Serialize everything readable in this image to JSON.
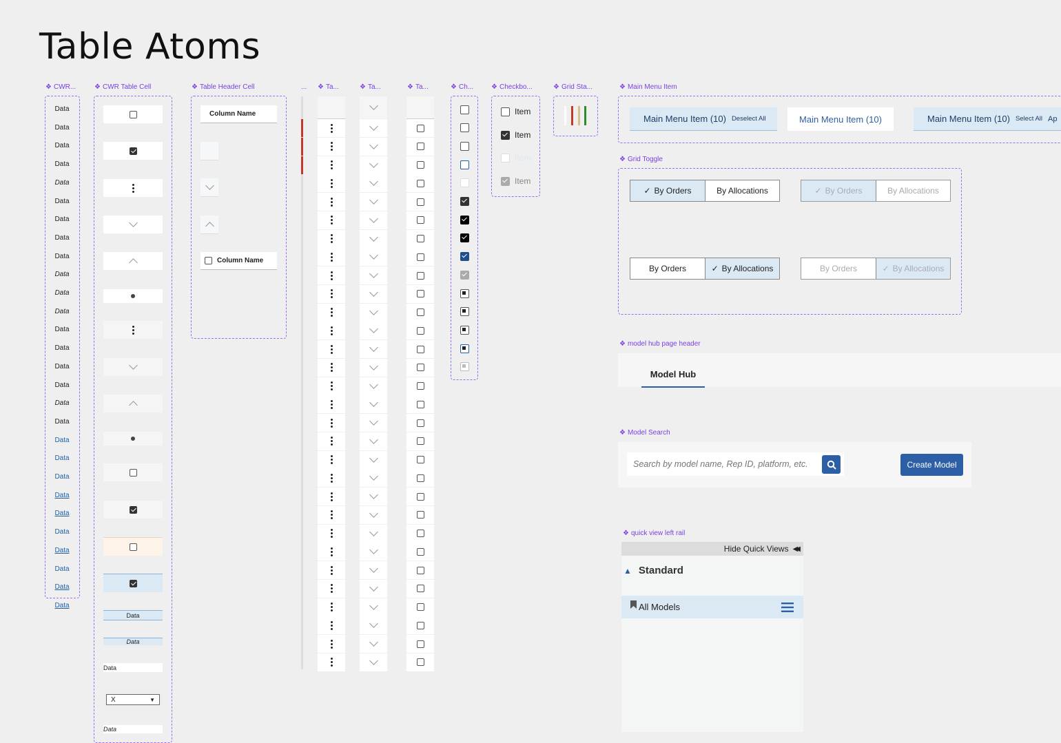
{
  "page": {
    "title": "Table Atoms"
  },
  "labels": {
    "cwr_col": "CWR...",
    "cwr_table_cell": "CWR Table Cell",
    "table_header_cell": "Table Header Cell",
    "dots": "...",
    "ta1": "Ta...",
    "ta2": "Ta...",
    "ta3": "Ta...",
    "ch": "Ch...",
    "checkbox": "Checkbo...",
    "grid_sta": "Grid Sta...",
    "main_menu_item": "Main Menu Item",
    "grid_toggle": "Grid Toggle",
    "model_hub_page_header": "model hub page header",
    "model_search": "Model Search",
    "quick_view_left_rail": "quick view left rail"
  },
  "cwr_data": [
    "Data",
    "Data",
    "Data",
    "Data",
    "Data",
    "Data",
    "Data",
    "Data",
    "Data",
    "Data",
    "Data",
    "Data",
    "Data",
    "Data",
    "Data",
    "Data",
    "Data",
    "Data",
    "Data",
    "Data",
    "Data",
    "Data",
    "Data",
    "Data",
    "Data",
    "Data",
    "Data",
    "Data"
  ],
  "cwr_table_cell": {
    "data1": "Data",
    "data2": "Data",
    "data3": "Data",
    "select_value": "X",
    "data4": "Data"
  },
  "header_cell": {
    "column_name": "Column Name",
    "column_name_cb": "Column Name"
  },
  "checkbox_group": {
    "items": [
      "Item",
      "Item",
      "Item",
      "Item"
    ]
  },
  "main_menu": {
    "item1": "Main Menu Item (10)",
    "item1_action": "Deselect All",
    "item2": "Main Menu Item (10)",
    "item3": "Main Menu Item (10)",
    "item3_action": "Select All",
    "item3_more": "Ap"
  },
  "grid_toggle": {
    "by_orders": "By Orders",
    "by_allocations": "By Allocations"
  },
  "model_hub": {
    "tab": "Model Hub"
  },
  "model_search": {
    "placeholder": "Search by model name, Rep ID, platform, etc.",
    "create_button": "Create Model"
  },
  "quick_view": {
    "hide": "Hide Quick Views",
    "section": "Standard",
    "item": "All Models"
  },
  "colors": {
    "accent": "#7b3fe4",
    "primary": "#2d5fa6",
    "selected_bg": "#dbe9f5"
  }
}
